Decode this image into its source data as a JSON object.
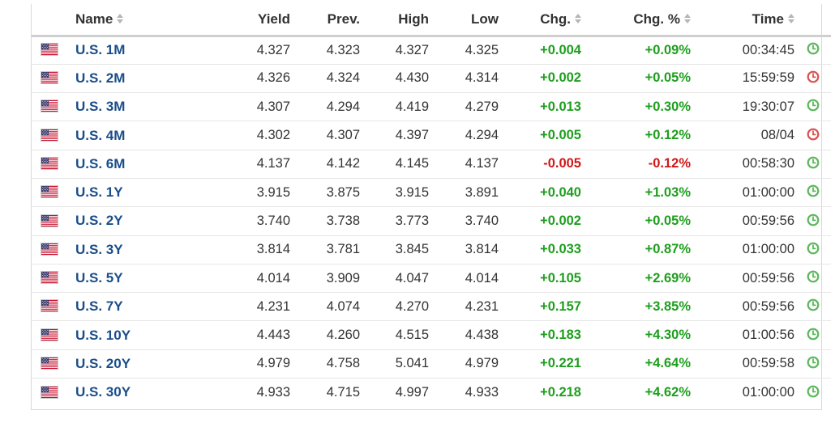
{
  "table": {
    "headers": {
      "name": "Name",
      "yield": "Yield",
      "prev": "Prev.",
      "high": "High",
      "low": "Low",
      "chg": "Chg.",
      "chg_pct": "Chg. %",
      "time": "Time"
    },
    "icons": {
      "flag": "us-flag-icon",
      "sort": "sort-icon",
      "clock_open": "clock-green-icon",
      "clock_closed": "clock-red-icon"
    },
    "colors": {
      "name_link": "#1a4e8a",
      "positive": "#1e9e1e",
      "negative": "#d01818",
      "clock_open": "#5cb85c",
      "clock_closed": "#d9534f"
    },
    "rows": [
      {
        "name": "U.S. 1M",
        "yield": "4.327",
        "prev": "4.323",
        "high": "4.327",
        "low": "4.325",
        "chg": "+0.004",
        "chg_pct": "+0.09%",
        "time": "00:34:45",
        "direction": "up",
        "status": "open"
      },
      {
        "name": "U.S. 2M",
        "yield": "4.326",
        "prev": "4.324",
        "high": "4.430",
        "low": "4.314",
        "chg": "+0.002",
        "chg_pct": "+0.05%",
        "time": "15:59:59",
        "direction": "up",
        "status": "closed"
      },
      {
        "name": "U.S. 3M",
        "yield": "4.307",
        "prev": "4.294",
        "high": "4.419",
        "low": "4.279",
        "chg": "+0.013",
        "chg_pct": "+0.30%",
        "time": "19:30:07",
        "direction": "up",
        "status": "open"
      },
      {
        "name": "U.S. 4M",
        "yield": "4.302",
        "prev": "4.307",
        "high": "4.397",
        "low": "4.294",
        "chg": "+0.005",
        "chg_pct": "+0.12%",
        "time": "08/04",
        "direction": "up",
        "status": "closed"
      },
      {
        "name": "U.S. 6M",
        "yield": "4.137",
        "prev": "4.142",
        "high": "4.145",
        "low": "4.137",
        "chg": "-0.005",
        "chg_pct": "-0.12%",
        "time": "00:58:30",
        "direction": "down",
        "status": "open"
      },
      {
        "name": "U.S. 1Y",
        "yield": "3.915",
        "prev": "3.875",
        "high": "3.915",
        "low": "3.891",
        "chg": "+0.040",
        "chg_pct": "+1.03%",
        "time": "01:00:00",
        "direction": "up",
        "status": "open"
      },
      {
        "name": "U.S. 2Y",
        "yield": "3.740",
        "prev": "3.738",
        "high": "3.773",
        "low": "3.740",
        "chg": "+0.002",
        "chg_pct": "+0.05%",
        "time": "00:59:56",
        "direction": "up",
        "status": "open"
      },
      {
        "name": "U.S. 3Y",
        "yield": "3.814",
        "prev": "3.781",
        "high": "3.845",
        "low": "3.814",
        "chg": "+0.033",
        "chg_pct": "+0.87%",
        "time": "01:00:00",
        "direction": "up",
        "status": "open"
      },
      {
        "name": "U.S. 5Y",
        "yield": "4.014",
        "prev": "3.909",
        "high": "4.047",
        "low": "4.014",
        "chg": "+0.105",
        "chg_pct": "+2.69%",
        "time": "00:59:56",
        "direction": "up",
        "status": "open"
      },
      {
        "name": "U.S. 7Y",
        "yield": "4.231",
        "prev": "4.074",
        "high": "4.270",
        "low": "4.231",
        "chg": "+0.157",
        "chg_pct": "+3.85%",
        "time": "00:59:56",
        "direction": "up",
        "status": "open"
      },
      {
        "name": "U.S. 10Y",
        "yield": "4.443",
        "prev": "4.260",
        "high": "4.515",
        "low": "4.438",
        "chg": "+0.183",
        "chg_pct": "+4.30%",
        "time": "01:00:56",
        "direction": "up",
        "status": "open"
      },
      {
        "name": "U.S. 20Y",
        "yield": "4.979",
        "prev": "4.758",
        "high": "5.041",
        "low": "4.979",
        "chg": "+0.221",
        "chg_pct": "+4.64%",
        "time": "00:59:58",
        "direction": "up",
        "status": "open"
      },
      {
        "name": "U.S. 30Y",
        "yield": "4.933",
        "prev": "4.715",
        "high": "4.997",
        "low": "4.933",
        "chg": "+0.218",
        "chg_pct": "+4.62%",
        "time": "01:00:00",
        "direction": "up",
        "status": "open"
      }
    ]
  }
}
